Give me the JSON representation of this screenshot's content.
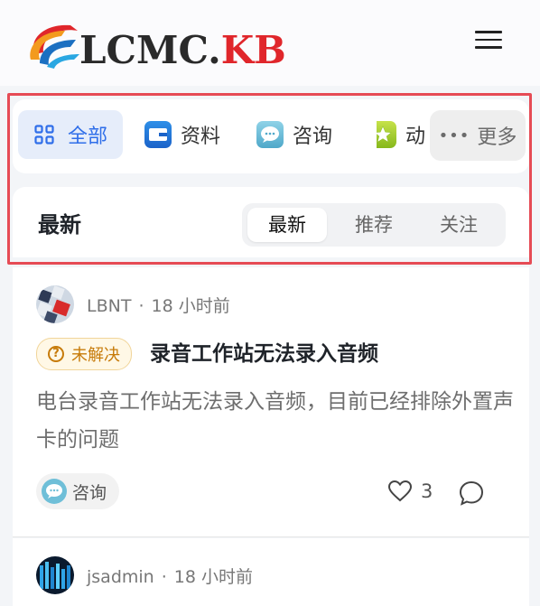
{
  "header": {
    "logo_text_main": "LCMC.",
    "logo_text_accent": "KB",
    "menu_icon": "hamburger-icon"
  },
  "categories": [
    {
      "label": "全部",
      "icon": "grid-icon",
      "active": true
    },
    {
      "label": "资料",
      "icon": "wallet-icon"
    },
    {
      "label": "咨询",
      "icon": "chat-bubble-icon"
    },
    {
      "label": "动",
      "icon": "star-icon"
    }
  ],
  "more_label": "更多",
  "sort": {
    "title": "最新",
    "options": [
      "最新",
      "推荐",
      "关注"
    ],
    "active": "最新"
  },
  "posts": [
    {
      "author": "LBNT",
      "time": "18 小时前",
      "status": "未解决",
      "title": "录音工作站无法录入音频",
      "body": "电台录音工作站无法录入音频，目前已经排除外置声卡的问题",
      "tag": "咨询",
      "likes": "3"
    },
    {
      "author": "jsadmin",
      "time": "18 小时前"
    }
  ],
  "colors": {
    "accent": "#2f6ee9",
    "brand_red": "#e0262b",
    "highlight_border": "#e64b55",
    "status_orange": "#c77b0a"
  }
}
